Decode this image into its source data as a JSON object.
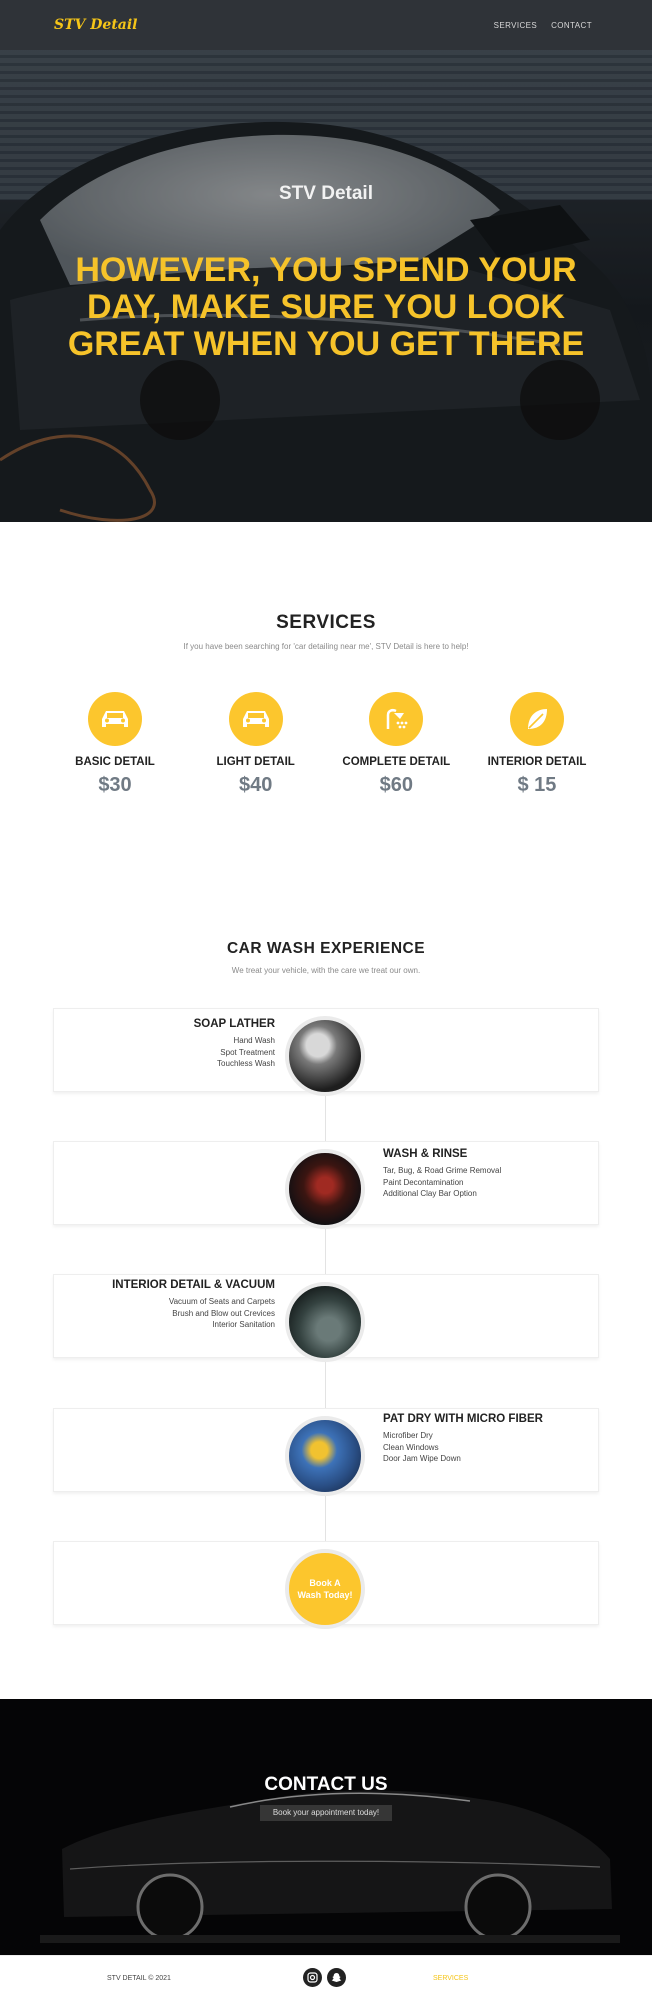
{
  "nav": {
    "brand": "STV Detail",
    "links": [
      "SERVICES",
      "CONTACT"
    ]
  },
  "hero": {
    "subtitle": "STV Detail",
    "title": "However, you spend your day, make sure you look great when you get there"
  },
  "services": {
    "heading": "SERVICES",
    "subheading": "If you have been searching for 'car detailing near me', STV Detail is here to help!",
    "items": [
      {
        "icon": "car-icon",
        "name": "BASIC DETAIL",
        "price": "$30"
      },
      {
        "icon": "car-icon",
        "name": "LIGHT DETAIL",
        "price": "$40"
      },
      {
        "icon": "shower-icon",
        "name": "COMPLETE DETAIL",
        "price": "$60"
      },
      {
        "icon": "leaf-icon",
        "name": "INTERIOR DETAIL",
        "price": "$ 15"
      }
    ]
  },
  "experience": {
    "heading": "CAR WASH EXPERIENCE",
    "subheading": "We treat your vehicle, with the care we treat our own.",
    "steps": [
      {
        "title": "SOAP LATHER",
        "lines": [
          "Hand Wash",
          "Spot Treatment",
          "Touchless Wash"
        ]
      },
      {
        "title": "WASH & RINSE",
        "lines": [
          "Tar, Bug, & Road Grime Removal",
          "Paint Decontamination",
          "Additional Clay Bar Option"
        ]
      },
      {
        "title": "INTERIOR DETAIL & VACUUM",
        "lines": [
          "Vacuum of Seats and Carpets",
          "Brush and Blow out Crevices",
          "Interior Sanitation"
        ]
      },
      {
        "title": "PAT DRY WITH MICRO FIBER",
        "lines": [
          "Microfiber Dry",
          "Clean Windows",
          "Door Jam Wipe Down"
        ]
      }
    ],
    "book_label": "Book A Wash Today!"
  },
  "contact": {
    "heading": "CONTACT US",
    "tagline": "Book your appointment today!"
  },
  "footer": {
    "copyright": "STV DETAIL © 2021",
    "icons": [
      "instagram-icon",
      "snapchat-icon"
    ],
    "link": "SERVICES"
  },
  "colors": {
    "accent": "#fcc62d",
    "nav_bg": "#2f3338",
    "price_grey": "#707a84"
  }
}
